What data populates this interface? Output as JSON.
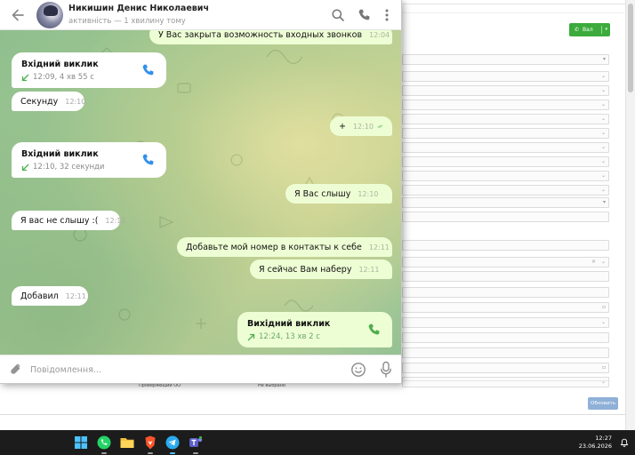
{
  "chat": {
    "name": "Никишин Денис Николаевич",
    "status": "активність — 1 хвилину тому",
    "input_placeholder": "Повідомлення..."
  },
  "messages": [
    {
      "type": "text",
      "dir": "out",
      "text": "У Вас закрыта возможность входных звонков",
      "time": "12:04"
    },
    {
      "type": "call",
      "dir": "in",
      "title": "Вхідний виклик",
      "meta": "12:09, 4 хв 55 с"
    },
    {
      "type": "text",
      "dir": "in",
      "text": "Секунду",
      "time": "12:10"
    },
    {
      "type": "text",
      "dir": "out",
      "text": "+",
      "time": "12:10"
    },
    {
      "type": "call",
      "dir": "in",
      "title": "Вхідний виклик",
      "meta": "12:10, 32 секунди"
    },
    {
      "type": "text",
      "dir": "out",
      "text": "Я Вас слышу",
      "time": "12:10"
    },
    {
      "type": "text",
      "dir": "in",
      "text": "Я вас не слышу :(",
      "time": "12:11"
    },
    {
      "type": "text",
      "dir": "out",
      "text": "Добавьте мой номер в контакты к себе",
      "time": "12:11"
    },
    {
      "type": "text",
      "dir": "out",
      "text": "Я сейчас Вам наберу",
      "time": "12:11"
    },
    {
      "type": "text",
      "dir": "in",
      "text": "Добавил",
      "time": "12:11"
    },
    {
      "type": "call",
      "dir": "out",
      "title": "Вихідний виклик",
      "meta": "12:24, 13 хв 2 с"
    }
  ],
  "crm": {
    "call_button": "Вал",
    "save_button": "Обновить",
    "bottom_row_left": "Проверяющий ОО",
    "bottom_row_right": "Не выбрано"
  },
  "taskbar": {
    "time": "12:27",
    "date": "23.06.2026"
  },
  "colors": {
    "outgoing_bubble": "#eefed4",
    "incoming_bubble": "#ffffff",
    "accent_blue": "#3390ec",
    "call_button_green": "#3cab3c"
  }
}
